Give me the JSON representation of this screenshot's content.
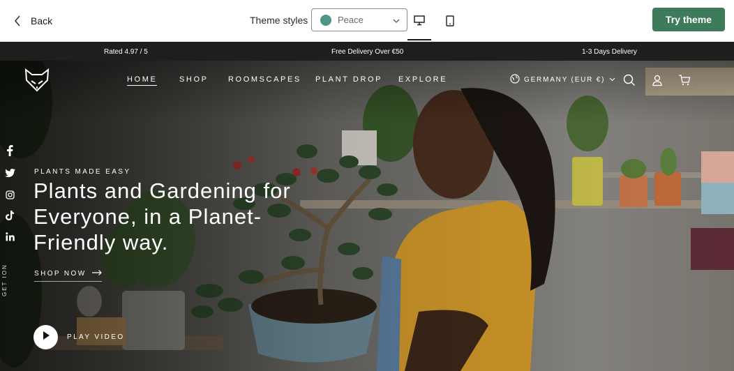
{
  "topbar": {
    "back_label": "Back",
    "theme_styles_label": "Theme styles",
    "selected_style": "Peace",
    "selected_style_color": "#4f9688",
    "try_theme_label": "Try theme",
    "try_theme_color": "#3e7b5a",
    "icons": {
      "back": "chevron-left-icon",
      "dropdown": "chevron-down-icon",
      "desktop": "desktop-icon",
      "mobile": "mobile-icon"
    }
  },
  "announcement": {
    "background": "#1e1e1e",
    "items": [
      "Rated 4.97 / 5",
      "Free Delivery Over €50",
      "1-3 Days Delivery"
    ]
  },
  "store_header": {
    "logo_icon": "fox-logo-icon",
    "nav": [
      {
        "label": "HOME",
        "active": true
      },
      {
        "label": "SHOP",
        "active": false
      },
      {
        "label": "ROOMSCAPES",
        "active": false
      },
      {
        "label": "PLANT DROP",
        "active": false
      },
      {
        "label": "EXPLORE",
        "active": false
      }
    ],
    "region_label": "GERMANY (EUR €)",
    "icons": [
      "globe-icon",
      "search-icon",
      "account-icon",
      "cart-icon"
    ]
  },
  "social": [
    "facebook-icon",
    "twitter-icon",
    "instagram-icon",
    "tiktok-icon",
    "linkedin-icon"
  ],
  "side_text": "GET ION",
  "hero": {
    "eyebrow": "PLANTS MADE EASY",
    "headline": "Plants and Gardening for Everyone, in a Planet-Friendly way.",
    "cta_label": "SHOP NOW",
    "video_label": "PLAY VIDEO"
  }
}
